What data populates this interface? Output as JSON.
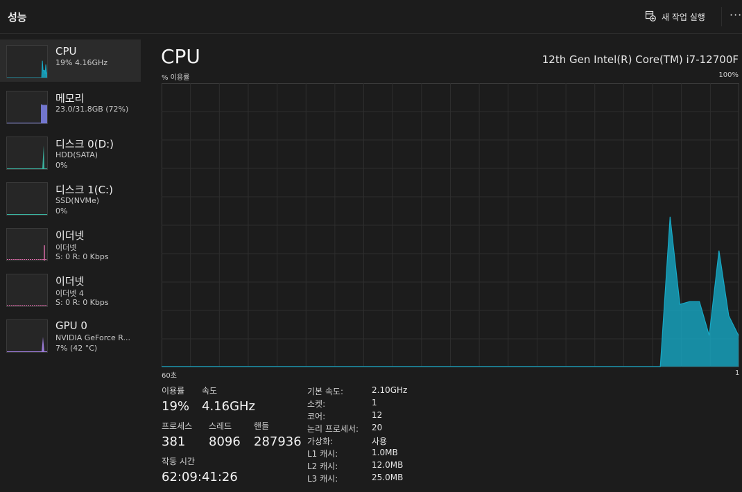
{
  "header": {
    "title": "성능",
    "run_task_label": "새 작업 실행",
    "more_label": "···"
  },
  "sidebar": {
    "items": [
      {
        "name": "CPU",
        "sub1": "19%  4.16GHz",
        "sub2": "",
        "color": "#17a9c6"
      },
      {
        "name": "메모리",
        "sub1": "23.0/31.8GB (72%)",
        "sub2": "",
        "color": "#7b7fe0"
      },
      {
        "name": "디스크 0(D:)",
        "sub1": "HDD(SATA)",
        "sub2": "0%",
        "color": "#3bb3a0"
      },
      {
        "name": "디스크 1(C:)",
        "sub1": "SSD(NVMe)",
        "sub2": "0%",
        "color": "#3bb3a0"
      },
      {
        "name": "이더넷",
        "sub1": "이더넷",
        "sub2": "S: 0  R: 0 Kbps",
        "color": "#d86aa6"
      },
      {
        "name": "이더넷",
        "sub1": "이더넷 4",
        "sub2": "S: 0  R: 0 Kbps",
        "color": "#d86aa6"
      },
      {
        "name": "GPU 0",
        "sub1": "NVIDIA GeForce R...",
        "sub2": "7% (42 °C)",
        "color": "#9a7ad6"
      }
    ]
  },
  "main": {
    "title": "CPU",
    "model": "12th Gen Intel(R) Core(TM) i7-12700F",
    "axis_top_left": "% 이용률",
    "axis_top_right": "100%",
    "axis_bottom_left": "60초",
    "axis_bottom_right": "1"
  },
  "stats": {
    "usage_label": "이용률",
    "usage_value": "19%",
    "speed_label": "속도",
    "speed_value": "4.16GHz",
    "process_label": "프로세스",
    "process_value": "381",
    "thread_label": "스레드",
    "thread_value": "8096",
    "handle_label": "핸들",
    "handle_value": "287936",
    "uptime_label": "작동 시간",
    "uptime_value": "62:09:41:26"
  },
  "specs": [
    {
      "key": "기본 속도:",
      "value": "2.10GHz"
    },
    {
      "key": "소켓:",
      "value": "1"
    },
    {
      "key": "코어:",
      "value": "12"
    },
    {
      "key": "논리 프로세서:",
      "value": "20"
    },
    {
      "key": "가상화:",
      "value": "사용"
    },
    {
      "key": "L1 캐시:",
      "value": "1.0MB"
    },
    {
      "key": "L2 캐시:",
      "value": "12.0MB"
    },
    {
      "key": "L3 캐시:",
      "value": "25.0MB"
    }
  ],
  "chart_data": {
    "type": "area",
    "x": [
      60,
      59,
      58,
      57,
      56,
      55,
      54,
      53,
      52,
      51,
      50,
      49,
      48,
      47,
      46,
      45,
      44,
      43,
      42,
      41,
      40,
      39,
      38,
      37,
      36,
      35,
      34,
      33,
      32,
      31,
      30,
      29,
      28,
      27,
      26,
      25,
      24,
      23,
      22,
      21,
      20,
      19,
      18,
      17,
      16,
      15,
      14,
      13,
      12,
      11,
      10,
      9,
      8,
      7,
      6,
      5,
      4,
      3,
      2,
      1
    ],
    "values": [
      0,
      0,
      0,
      0,
      0,
      0,
      0,
      0,
      0,
      0,
      0,
      0,
      0,
      0,
      0,
      0,
      0,
      0,
      0,
      0,
      0,
      0,
      0,
      0,
      0,
      0,
      0,
      0,
      0,
      0,
      0,
      0,
      0,
      0,
      0,
      0,
      0,
      0,
      0,
      0,
      0,
      0,
      0,
      0,
      0,
      0,
      0,
      0,
      0,
      0,
      0,
      0,
      53,
      22,
      23,
      23,
      11,
      41,
      18,
      11
    ],
    "ylim": [
      0,
      100
    ],
    "xlim": [
      60,
      1
    ],
    "grid": true,
    "color": "#17a9c6"
  }
}
